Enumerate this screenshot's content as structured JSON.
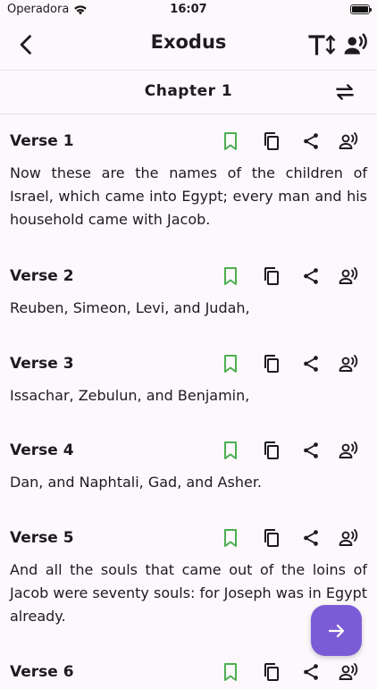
{
  "status_bar": {
    "carrier": "Operadora",
    "time": "16:07"
  },
  "app_bar": {
    "title": "Exodus",
    "back_icon": "chevron-left-icon",
    "text_size_icon": "text-size-icon",
    "listen_icon": "record-voice-icon"
  },
  "chapter_bar": {
    "title": "Chapter 1",
    "swap_icon": "swap-horiz-icon"
  },
  "colors": {
    "bookmark": "#4caf50",
    "accent": "#7b5cd6",
    "background": "#fcf8fc"
  },
  "verses": [
    {
      "title": "Verse 1",
      "text": "Now these are the names of the children of Israel, which came into Egypt; every man and his household came with Jacob."
    },
    {
      "title": "Verse 2",
      "text": "Reuben, Simeon, Levi, and Judah,"
    },
    {
      "title": "Verse 3",
      "text": "Issachar, Zebulun, and Benjamin,"
    },
    {
      "title": "Verse 4",
      "text": "Dan, and Naphtali, Gad, and Asher."
    },
    {
      "title": "Verse 5",
      "text": "And all the souls that came out of the loins of Jacob were seventy souls: for Joseph was in Egypt already."
    },
    {
      "title": "Verse 6",
      "text": ""
    }
  ],
  "fab": {
    "icon": "arrow-right-icon"
  }
}
